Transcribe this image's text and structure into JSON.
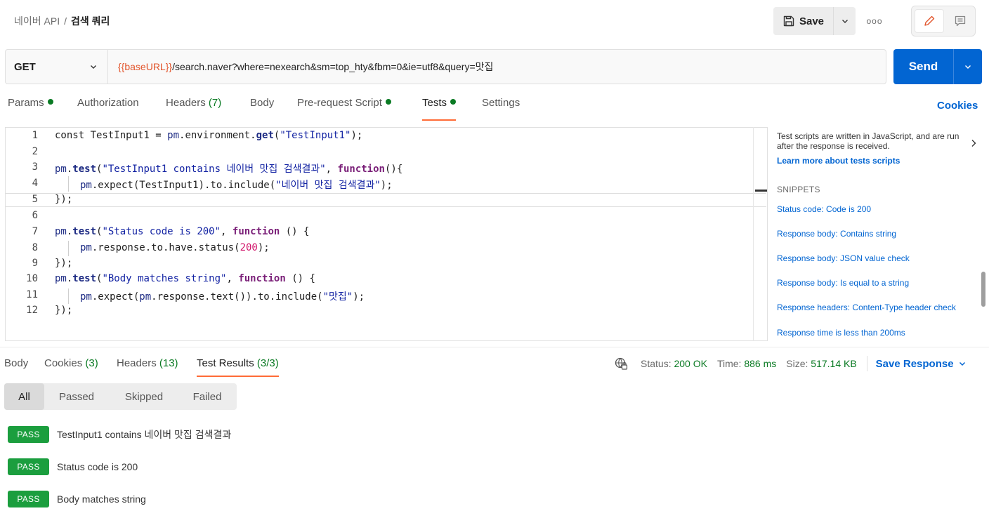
{
  "header": {
    "breadcrumb_parent": "네이버 API",
    "breadcrumb_sep": "/",
    "breadcrumb_current": "검색 쿼리",
    "save_label": "Save",
    "more_label": "ooo"
  },
  "request": {
    "method": "GET",
    "url_variable": "{{baseURL}}",
    "url_path": "/search.naver?where=nexearch&sm=top_hty&fbm=0&ie=utf8&query=맛집",
    "send_label": "Send"
  },
  "req_tabs": {
    "params": "Params",
    "authorization": "Authorization",
    "headers": "Headers",
    "headers_count": "(7)",
    "body": "Body",
    "prerequest": "Pre-request Script",
    "tests": "Tests",
    "settings": "Settings",
    "cookies": "Cookies"
  },
  "editor": {
    "line_numbers": [
      "1",
      "2",
      "3",
      "4",
      "5",
      "6",
      "7",
      "8",
      "9",
      "10",
      "11",
      "12"
    ],
    "l1_a": "const TestInput1 = ",
    "l1_pm": "pm",
    "l1_b": ".environment.",
    "l1_get": "get",
    "l1_c": "(",
    "l1_str": "\"TestInput1\"",
    "l1_d": ");",
    "l3_pm": "pm",
    "l3_dot": ".",
    "l3_test": "test",
    "l3_paren": "(",
    "l3_str": "\"TestInput1 contains 네이버 맛집 검색결과\"",
    "l3_comma": ", ",
    "l3_fn": "function",
    "l3_end": "(){",
    "l4_pm": "pm",
    "l4_a": ".expect(TestInput1).to.include(",
    "l4_str": "\"네이버 맛집 검색결과\"",
    "l4_end": ");",
    "l5": "});",
    "l7_pm": "pm",
    "l7_dot": ".",
    "l7_test": "test",
    "l7_paren": "(",
    "l7_str": "\"Status code is 200\"",
    "l7_comma": ", ",
    "l7_fn": "function",
    "l7_end": " () {",
    "l8_pm": "pm",
    "l8_a": ".response.to.have.status(",
    "l8_num": "200",
    "l8_end": ");",
    "l9": "});",
    "l10_pm": "pm",
    "l10_dot": ".",
    "l10_test": "test",
    "l10_paren": "(",
    "l10_str": "\"Body matches string\"",
    "l10_comma": ", ",
    "l10_fn": "function",
    "l10_end": " () {",
    "l11_pm": "pm",
    "l11_a": ".expect(",
    "l11_pm2": "pm",
    "l11_b": ".response.text()).to.include(",
    "l11_str": "\"맛집\"",
    "l11_end": ");",
    "l12": "});"
  },
  "side_panel": {
    "intro": "Test scripts are written in JavaScript, and are run after the response is received.",
    "learn_more": "Learn more about tests scripts",
    "snippets_title": "SNIPPETS",
    "snippets": [
      "Status code: Code is 200",
      "Response body: Contains string",
      "Response body: JSON value check",
      "Response body: Is equal to a string",
      "Response headers: Content-Type header check",
      "Response time is less than 200ms"
    ]
  },
  "response": {
    "tabs": {
      "body": "Body",
      "cookies": "Cookies",
      "cookies_count": "(3)",
      "headers": "Headers",
      "headers_count": "(13)",
      "test_results": "Test Results",
      "test_results_count": "(3/3)"
    },
    "status_label": "Status:",
    "status_value": "200 OK",
    "time_label": "Time:",
    "time_value": "886 ms",
    "size_label": "Size:",
    "size_value": "517.14 KB",
    "save_response": "Save Response",
    "filters": [
      "All",
      "Passed",
      "Skipped",
      "Failed"
    ],
    "results": [
      {
        "badge": "PASS",
        "name": "TestInput1 contains 네이버 맛집 검색결과"
      },
      {
        "badge": "PASS",
        "name": "Status code is 200"
      },
      {
        "badge": "PASS",
        "name": "Body matches string"
      }
    ]
  },
  "colors": {
    "accent_orange": "#ff6c37",
    "send_blue": "#0265d2",
    "pass_green": "#1b9e3e",
    "status_green": "#0a7a23"
  }
}
